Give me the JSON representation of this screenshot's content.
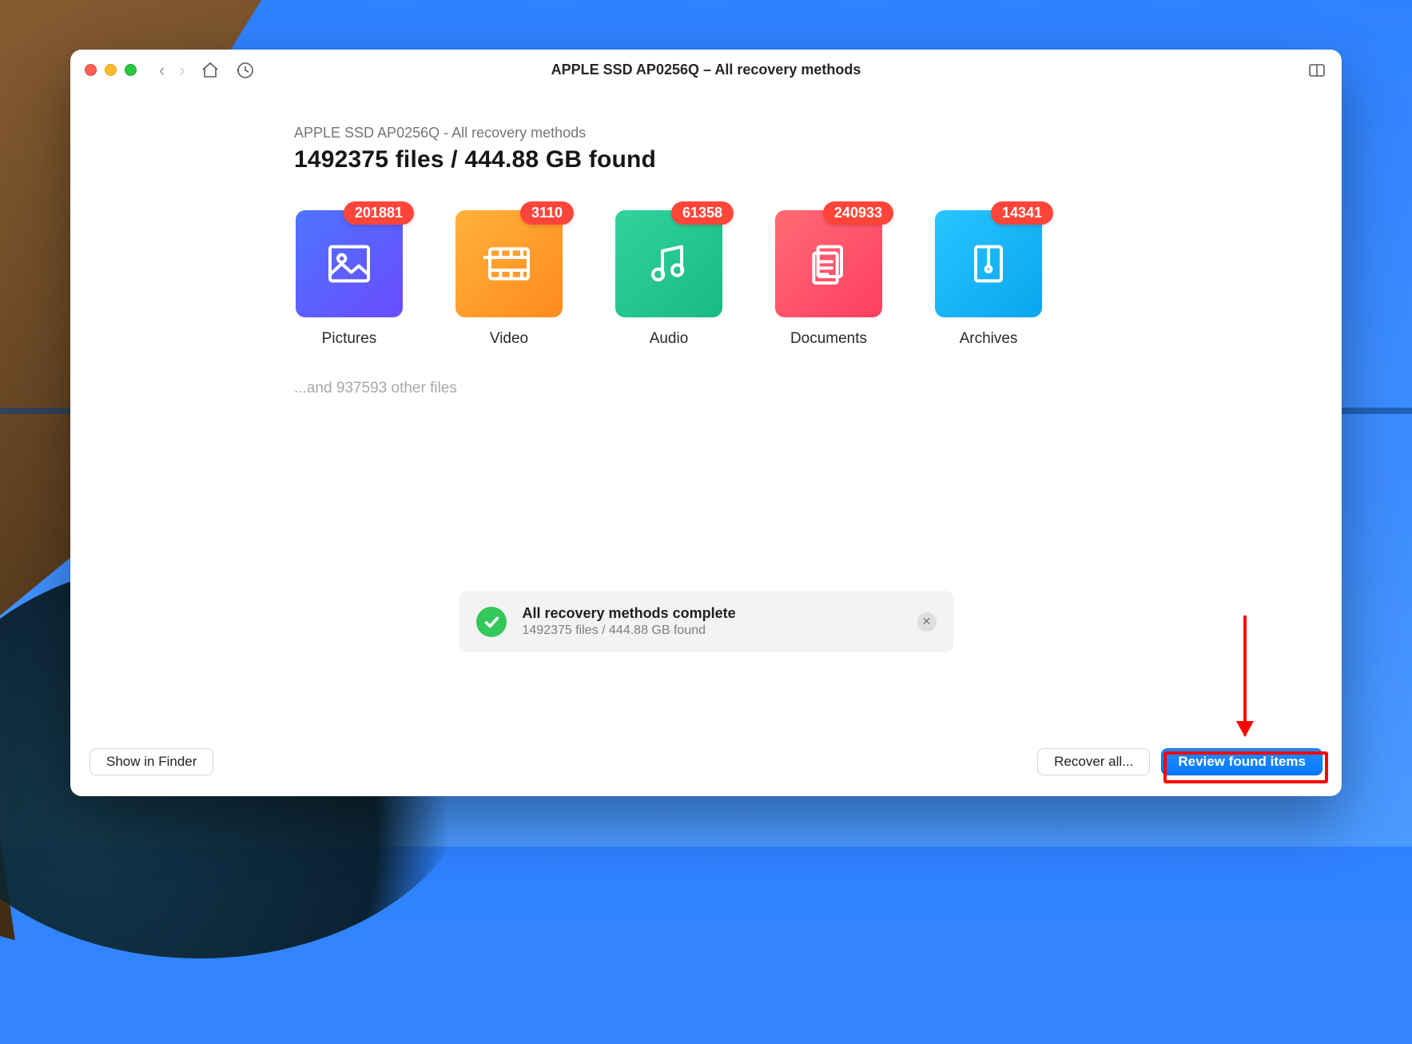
{
  "window": {
    "title": "APPLE SSD AP0256Q – All recovery methods"
  },
  "breadcrumb": "APPLE SSD AP0256Q - All recovery methods",
  "headline": "1492375 files / 444.88 GB found",
  "tiles": [
    {
      "label": "Pictures",
      "badge": "201881"
    },
    {
      "label": "Video",
      "badge": "3110"
    },
    {
      "label": "Audio",
      "badge": "61358"
    },
    {
      "label": "Documents",
      "badge": "240933"
    },
    {
      "label": "Archives",
      "badge": "14341"
    }
  ],
  "other_files": "...and 937593 other files",
  "status": {
    "title": "All recovery methods complete",
    "subtitle": "1492375 files / 444.88 GB found"
  },
  "footer": {
    "show_in_finder": "Show in Finder",
    "recover_all": "Recover all...",
    "review": "Review found items"
  }
}
